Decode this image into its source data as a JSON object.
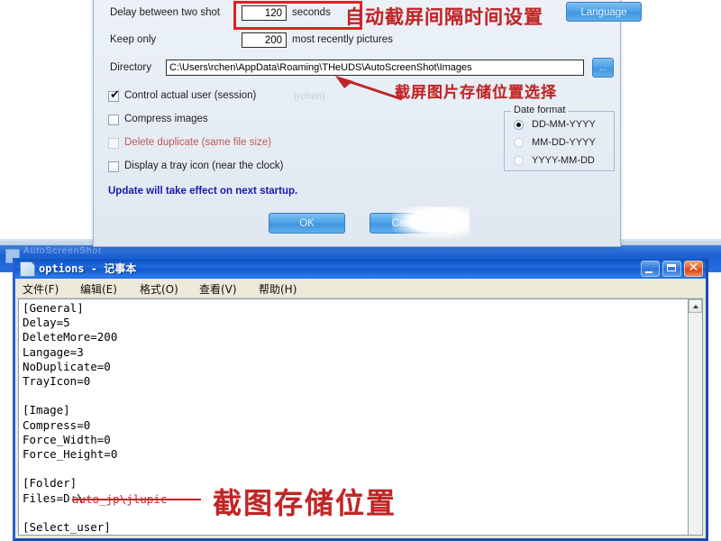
{
  "options_dialog": {
    "fields": {
      "delay_label": "Delay between two shot",
      "delay_value": "120",
      "delay_unit": "seconds",
      "keep_label": "Keep only",
      "keep_value": "200",
      "keep_unit": "most recently pictures",
      "directory_label": "Directory",
      "directory_value": "C:\\Users\\rchen\\AppData\\Roaming\\THeUDS\\AutoScreenShot\\Images",
      "browse_label": "..."
    },
    "checkboxes": [
      {
        "label": "Control actual user (session)",
        "checked": true,
        "disabled": false,
        "red": false
      },
      {
        "label": "Compress images",
        "checked": false,
        "disabled": false,
        "red": false
      },
      {
        "label": "Delete duplicate (same file size)",
        "checked": false,
        "disabled": true,
        "red": true
      },
      {
        "label": "Display a tray icon (near the clock)",
        "checked": false,
        "disabled": false,
        "red": false
      }
    ],
    "session_user": "(rchen)",
    "update_note": "Update will take effect on next startup.",
    "date_format": {
      "legend": "Date format",
      "options": [
        "DD-MM-YYYY",
        "MM-DD-YYYY",
        "YYYY-MM-DD"
      ],
      "selected": "DD-MM-YYYY"
    },
    "buttons": {
      "language": "Language",
      "ok": "OK",
      "cancel": "Cancel"
    },
    "accent_color": "#3f96e2",
    "highlight_color": "#e02020"
  },
  "annotations": {
    "interval": "自动截屏间隔时间设置",
    "directory": "截屏图片存储位置选择",
    "storage": "截图存储位置",
    "color": "#c02626"
  },
  "notepad": {
    "title": "options - 记事本",
    "menu": [
      "文件(F)",
      "编辑(E)",
      "格式(O)",
      "查看(V)",
      "帮助(H)"
    ],
    "window_buttons": {
      "minimize": "minimize",
      "maximize": "maximize",
      "close": "close"
    },
    "content": "[General]\nDelay=5\nDeleteMore=200\nLangage=3\nNoDuplicate=0\nTrayIcon=0\n\n[Image]\nCompress=0\nForce_Width=0\nForce_Height=0\n\n[Folder]\nFiles=D:\\\n\n[Select_user]",
    "struck_text": "auto_jp\\jlupic",
    "titlebar_color": "#1458cc"
  },
  "background": {
    "hidden_window_title": "AutoScreenShot"
  }
}
